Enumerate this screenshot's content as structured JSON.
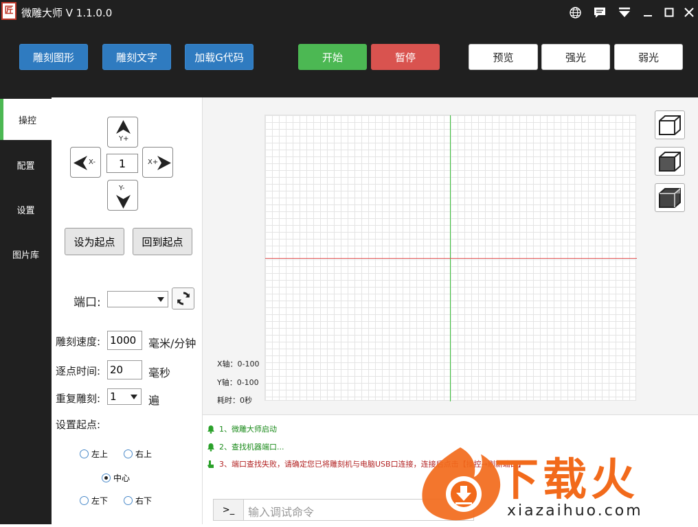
{
  "titlebar": {
    "logo": "匠",
    "title": "微雕大师 V 1.1.0.0"
  },
  "toolbar": {
    "engrave_image": "雕刻图形",
    "engrave_text": "雕刻文字",
    "load_gcode": "加载G代码",
    "start": "开始",
    "pause": "暂停",
    "preview": "预览",
    "strong_light": "强光",
    "weak_light": "弱光"
  },
  "sidebar": {
    "items": [
      {
        "label": "操控",
        "active": true
      },
      {
        "label": "配置",
        "active": false
      },
      {
        "label": "设置",
        "active": false
      },
      {
        "label": "图片库",
        "active": false
      }
    ]
  },
  "jog": {
    "y_plus": "Y+",
    "y_minus": "Y-",
    "x_minus": "X-",
    "x_plus": "X+",
    "step": "1"
  },
  "origin": {
    "set_origin": "设为起点",
    "return_origin": "回到起点"
  },
  "port": {
    "label": "端口:",
    "value": ""
  },
  "settings": {
    "speed_label": "雕刻速度:",
    "speed_value": "1000",
    "speed_unit": "毫米/分钟",
    "dwell_label": "逐点时间:",
    "dwell_value": "20",
    "dwell_unit": "毫秒",
    "repeat_label": "重复雕刻:",
    "repeat_value": "1",
    "repeat_unit": "遍",
    "start_point_label": "设置起点:"
  },
  "start_points": {
    "top_left": "左上",
    "top_right": "右上",
    "center": "中心",
    "bottom_left": "左下",
    "bottom_right": "右下",
    "selected": "中心"
  },
  "canvas": {
    "x_axis": "X轴：0-100",
    "y_axis": "Y轴：0-100",
    "time": "耗时：0秒"
  },
  "log": [
    {
      "text": "1、微雕大师启动",
      "color": "#1a8a1a"
    },
    {
      "text": "2、查找机器端口...",
      "color": "#1a8a1a"
    },
    {
      "text": "3、端口查找失败，请确定您已将雕刻机与电脑USB口连接，连接后点击【操控→刷新端口】",
      "color": "#b22222"
    }
  ],
  "command": {
    "prompt": ">_",
    "placeholder": "输入调试命令"
  },
  "watermark": {
    "brand": "下载火",
    "url": "xiazaihuo.com"
  },
  "colors": {
    "accent_green": "#4cb853",
    "accent_red": "#d9534f",
    "accent_blue": "#2f7bc0"
  }
}
